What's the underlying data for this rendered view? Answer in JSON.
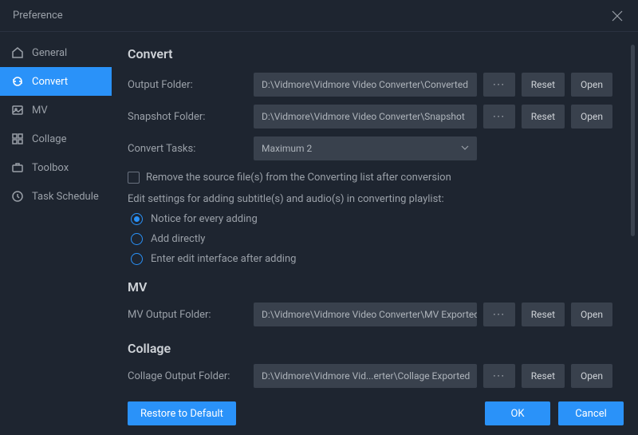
{
  "titlebar": {
    "title": "Preference"
  },
  "sidebar": {
    "items": [
      {
        "label": "General"
      },
      {
        "label": "Convert"
      },
      {
        "label": "MV"
      },
      {
        "label": "Collage"
      },
      {
        "label": "Toolbox"
      },
      {
        "label": "Task Schedule"
      }
    ]
  },
  "sections": {
    "convert": {
      "title": "Convert",
      "output_label": "Output Folder:",
      "output_path": "D:\\Vidmore\\Vidmore Video Converter\\Converted",
      "snapshot_label": "Snapshot Folder:",
      "snapshot_path": "D:\\Vidmore\\Vidmore Video Converter\\Snapshot",
      "tasks_label": "Convert Tasks:",
      "tasks_value": "Maximum 2",
      "checkbox_label": "Remove the source file(s) from the Converting list after conversion",
      "edit_help": "Edit settings for adding subtitle(s) and audio(s) in converting playlist:",
      "radio_notice": "Notice for every adding",
      "radio_direct": "Add directly",
      "radio_edit": "Enter edit interface after adding"
    },
    "mv": {
      "title": "MV",
      "output_label": "MV Output Folder:",
      "output_path": "D:\\Vidmore\\Vidmore Video Converter\\MV Exported"
    },
    "collage": {
      "title": "Collage",
      "output_label": "Collage Output Folder:",
      "output_path": "D:\\Vidmore\\Vidmore Vid...erter\\Collage Exported"
    }
  },
  "buttons": {
    "ellipsis": "···",
    "reset": "Reset",
    "open": "Open",
    "restore": "Restore to Default",
    "ok": "OK",
    "cancel": "Cancel"
  }
}
